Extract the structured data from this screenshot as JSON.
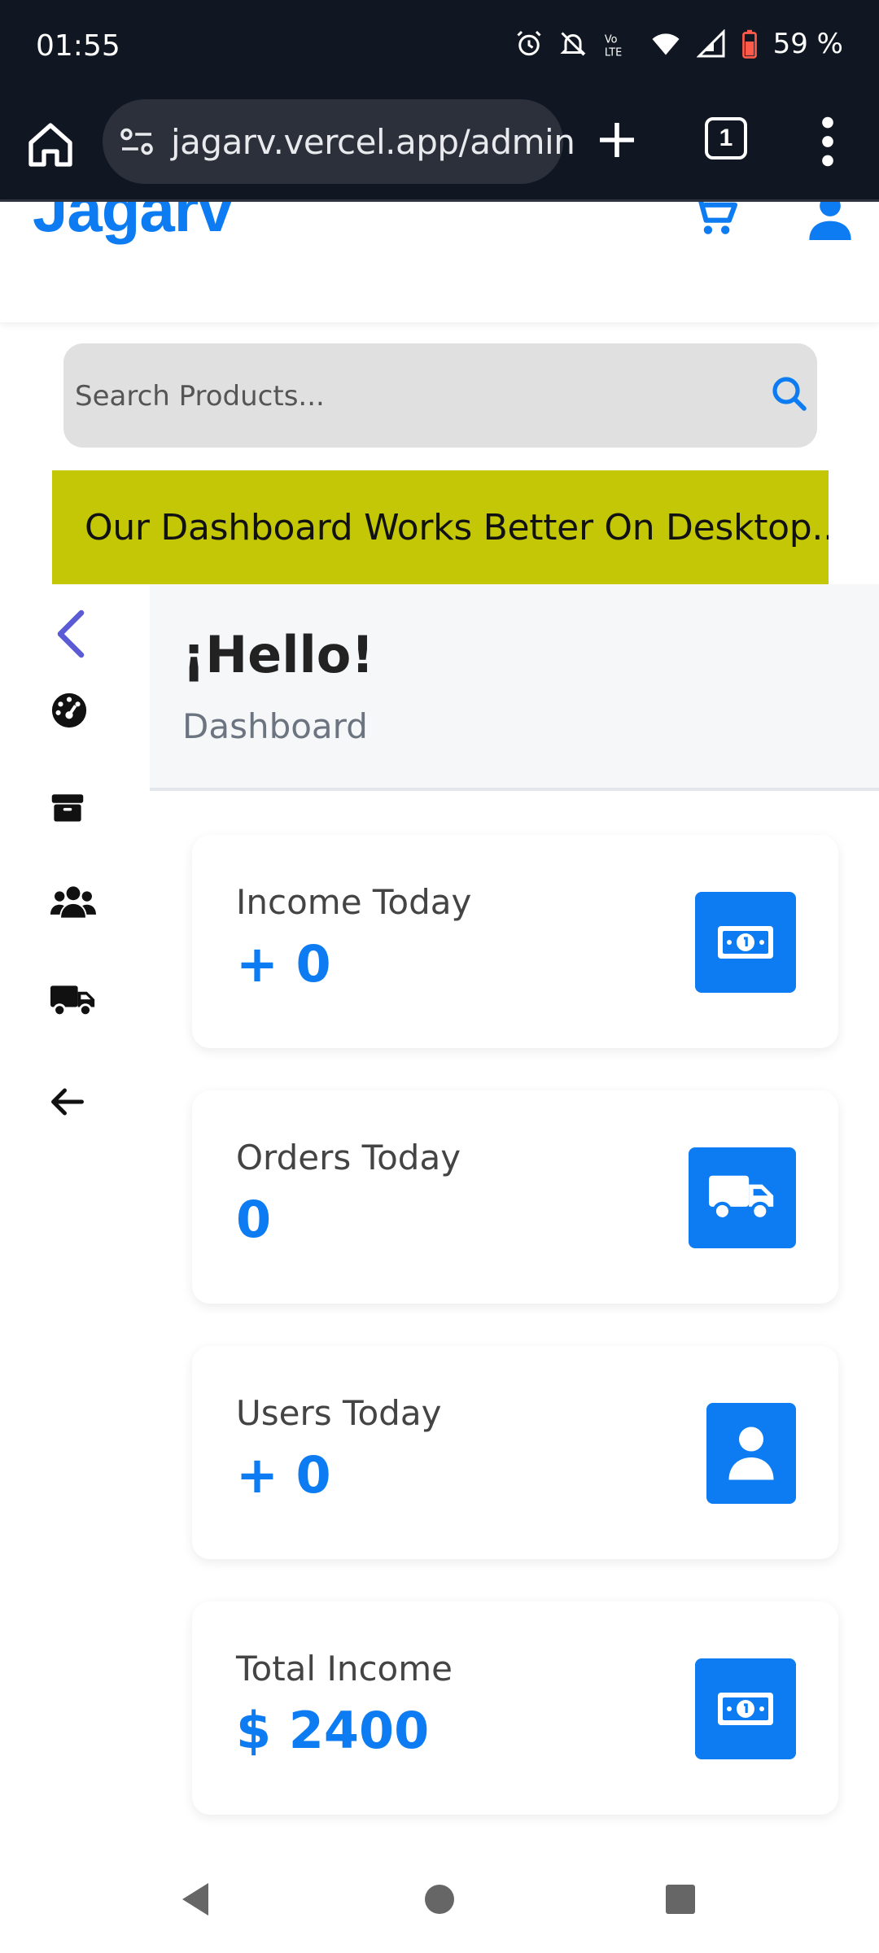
{
  "status_bar": {
    "time": "01:55",
    "battery": "59 %"
  },
  "browser": {
    "url": "jagarv.vercel.app/admin",
    "tab_count": "1"
  },
  "site": {
    "logo": "Jagarv"
  },
  "search": {
    "placeholder": "Search Products..."
  },
  "banner": {
    "text": "Our Dashboard Works Better On Desktop..."
  },
  "dashboard": {
    "greeting": "¡Hello!",
    "subtitle": "Dashboard"
  },
  "sidebar": {
    "items": [
      {
        "icon": "chevron-left-icon"
      },
      {
        "icon": "dashboard-gauge-icon"
      },
      {
        "icon": "box-icon"
      },
      {
        "icon": "users-icon"
      },
      {
        "icon": "truck-icon"
      },
      {
        "icon": "arrow-left-icon"
      }
    ]
  },
  "cards": [
    {
      "label": "Income Today",
      "value": "+ 0",
      "icon": "money-icon"
    },
    {
      "label": "Orders Today",
      "value": "0",
      "icon": "truck-icon"
    },
    {
      "label": "Users Today",
      "value": "+ 0",
      "icon": "user-icon"
    },
    {
      "label": "Total Income",
      "value": "$ 2400",
      "icon": "money-icon"
    }
  ],
  "colors": {
    "accent": "#0d7cf2",
    "banner": "#c3c705",
    "sidebar_chevron": "#5b5bd6"
  }
}
